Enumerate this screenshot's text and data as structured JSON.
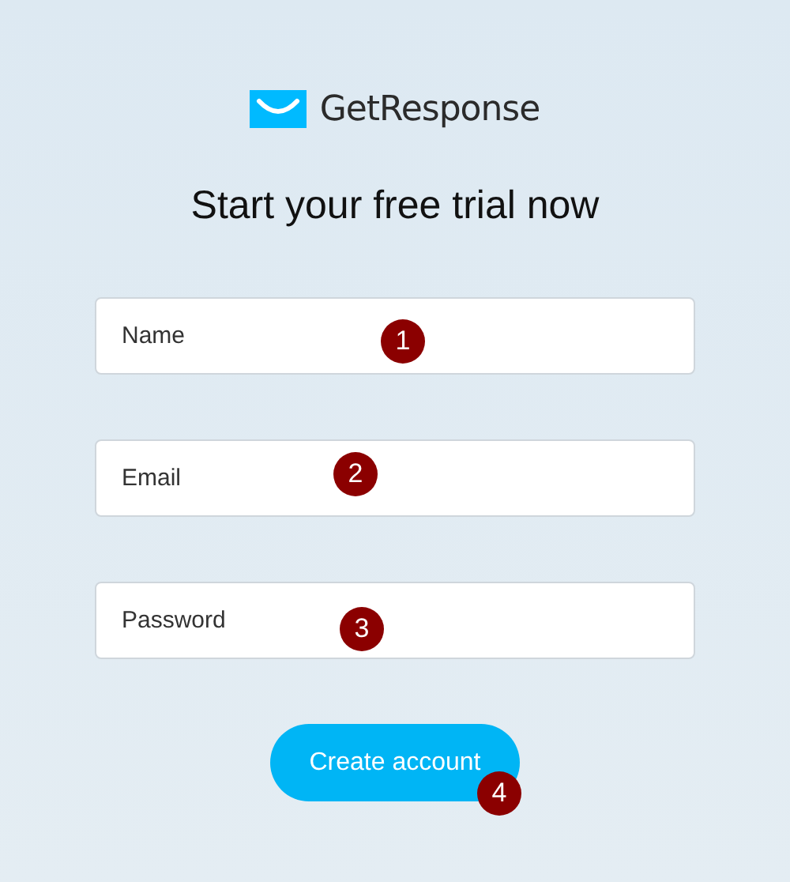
{
  "logo": {
    "text": "GetResponse"
  },
  "heading": "Start your free trial now",
  "fields": [
    {
      "placeholder": "Name",
      "marker": "1"
    },
    {
      "placeholder": "Email",
      "marker": "2"
    },
    {
      "placeholder": "Password",
      "marker": "3"
    }
  ],
  "button": {
    "label": "Create account",
    "marker": "4"
  }
}
